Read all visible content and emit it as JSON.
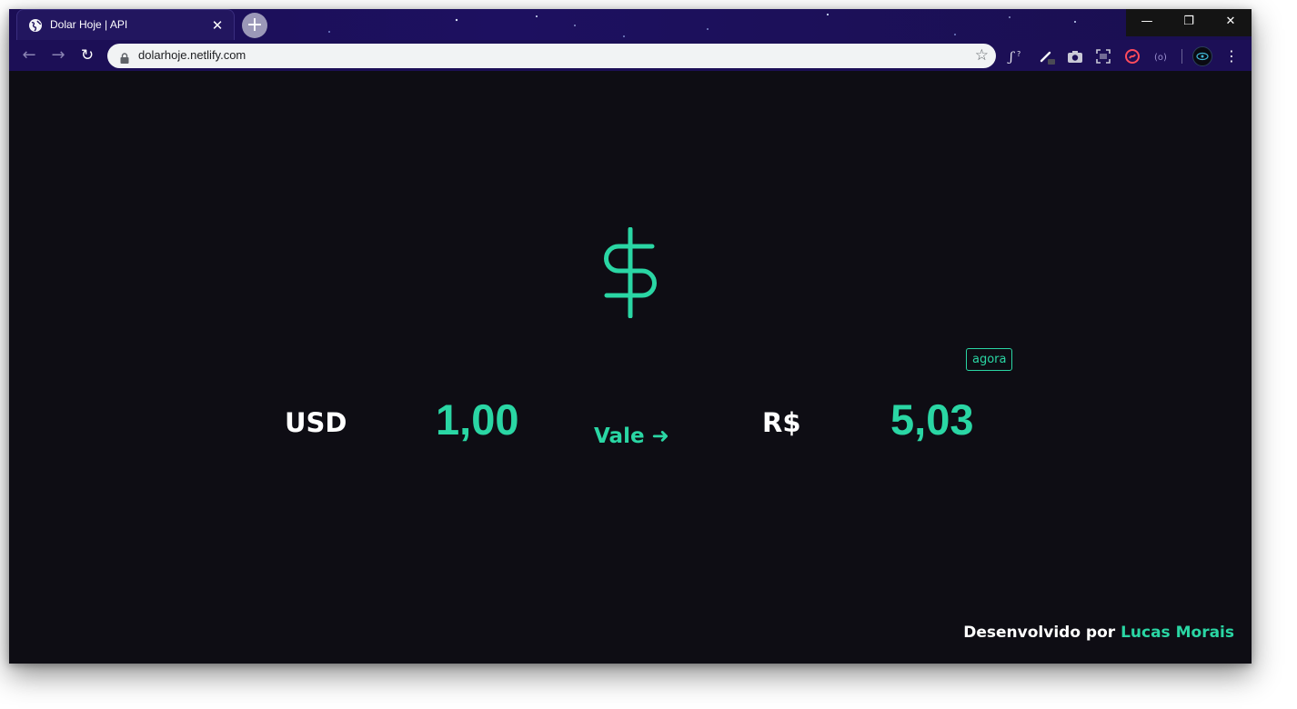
{
  "browser": {
    "tab_title": "Dolar Hoje | API",
    "tab_close": "✕",
    "new_tab": "+",
    "window_controls": {
      "minimize": "—",
      "maximize": "❐",
      "close": "✕"
    },
    "nav": {
      "back": "←",
      "forward": "→",
      "reload": "↻"
    },
    "url": "dolarhoje.netlify.com",
    "bookmark_star": "☆",
    "extensions": [
      "formula-icon",
      "pen-icon",
      "camera-icon",
      "screenshot-icon",
      "tiktok-icon",
      "cast-icon"
    ],
    "menu": "⋮"
  },
  "colors": {
    "accent": "#2ad6a4",
    "page_background": "#0e0d14",
    "browser_frame": "#1c0f56",
    "text": "#ffffff"
  },
  "converter": {
    "icon": "dollar-sign-icon",
    "updated_badge": "agora",
    "base_currency": "USD",
    "base_amount": "1,00",
    "relation": "Vale ➜",
    "target_currency": "R$",
    "target_amount": "5,03"
  },
  "footer": {
    "prefix": "Desenvolvido por ",
    "author": "Lucas Morais"
  }
}
